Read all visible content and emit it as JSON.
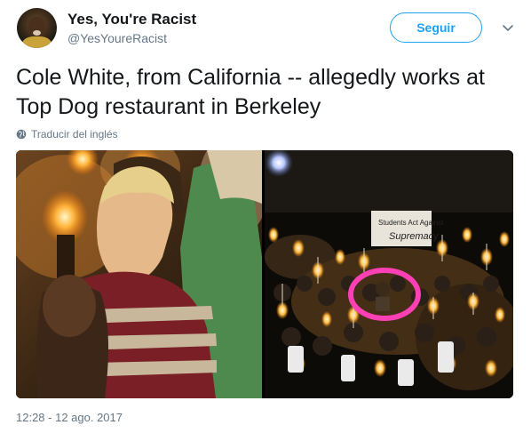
{
  "tweet": {
    "user_name": "Yes, You're Racist",
    "user_handle": "@YesYoureRacist",
    "follow_label": "Seguir",
    "text": "Cole White, from California -- allegedly works at Top Dog restaurant in Berkeley",
    "translate_label": "Traducir del inglés",
    "timestamp": "12:28 - 12 ago. 2017",
    "media": [
      {
        "description": "Close-up photo of a young man with blond hair in a striped shirt among torch-bearing crowd"
      },
      {
        "description": "Night photo of a large crowd carrying lit torches with a person circled in pink"
      }
    ],
    "sign_text": "Students Act Against White Supremacy"
  },
  "colors": {
    "accent": "#1da1f2",
    "secondary_text": "#657786",
    "highlight_circle": "#ff3fb4"
  },
  "icons": {
    "caret": "chevron-down-icon",
    "globe": "globe-icon"
  }
}
